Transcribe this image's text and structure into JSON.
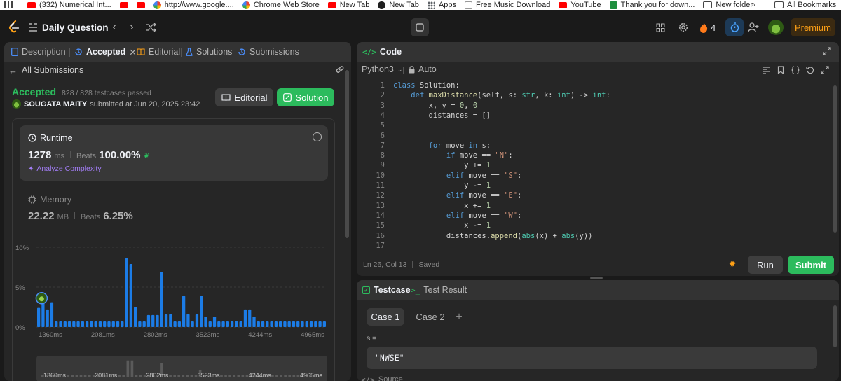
{
  "bookmarks": [
    {
      "label": "(332) Numerical Int...",
      "icon": "youtube-icon"
    },
    {
      "label": "",
      "icon": "youtube-icon"
    },
    {
      "label": "",
      "icon": "youtube-icon"
    },
    {
      "label": "http://www.google....",
      "icon": "google-icon"
    },
    {
      "label": "Chrome Web Store",
      "icon": "web-store-icon"
    },
    {
      "label": "New Tab",
      "icon": "youtube-icon"
    },
    {
      "label": "New Tab",
      "icon": "globe-icon"
    },
    {
      "label": "Apps",
      "icon": "apps-grid-icon"
    },
    {
      "label": "Free Music Download",
      "icon": "page-icon"
    },
    {
      "label": "YouTube",
      "icon": "youtube-icon"
    },
    {
      "label": "Thank you for down...",
      "icon": "download-icon"
    },
    {
      "label": "New folder",
      "icon": "folder-icon"
    }
  ],
  "bookmarks_overflow": "»",
  "all_bookmarks": "All Bookmarks",
  "topnav": {
    "title": "Daily Question",
    "streak": "4",
    "premium": "Premium"
  },
  "left_tabs": [
    "Description",
    "Accepted",
    "Editorial",
    "Solutions",
    "Submissions"
  ],
  "submission": {
    "back_label": "All Submissions",
    "status": "Accepted",
    "testcases": "828 / 828 testcases passed",
    "user": "SOUGATA MAITY",
    "submitted": "submitted at Jun 20, 2025 23:42",
    "editorial_btn": "Editorial",
    "solution_btn": "Solution"
  },
  "runtime": {
    "label": "Runtime",
    "value": "1278",
    "unit": "ms",
    "beats_label": "Beats",
    "beats": "100.00%",
    "analyze": "Analyze Complexity"
  },
  "memory": {
    "label": "Memory",
    "value": "22.22",
    "unit": "MB",
    "beats_label": "Beats",
    "beats": "6.25%"
  },
  "chart_data": {
    "type": "bar",
    "ylim": [
      0,
      10
    ],
    "yticks": [
      "10%",
      "5%",
      "0%"
    ],
    "xticks": [
      "1360ms",
      "2081ms",
      "2802ms",
      "3523ms",
      "4244ms",
      "4965ms"
    ],
    "values": [
      2.4,
      3.0,
      2.2,
      3.1,
      0.7,
      0.7,
      0.7,
      0.7,
      0.7,
      0.7,
      0.7,
      0.7,
      0.7,
      0.7,
      0.7,
      0.7,
      0.7,
      0.7,
      0.7,
      0.7,
      8.6,
      7.9,
      2.5,
      0.7,
      0.7,
      1.5,
      1.5,
      1.5,
      6.9,
      1.6,
      1.6,
      0.7,
      0.7,
      3.9,
      1.6,
      0.7,
      1.6,
      3.9,
      1.3,
      0.7,
      1.3,
      0.7,
      0.7,
      0.7,
      0.7,
      0.7,
      0.7,
      2.2,
      2.2,
      1.3,
      0.7,
      0.7,
      0.7,
      0.7,
      0.7,
      0.7,
      0.7,
      0.7,
      0.7,
      0.7,
      0.7,
      0.7,
      0.7,
      0.7,
      0.7,
      0.7
    ],
    "mini_xticks": [
      "1360ms",
      "2081ms",
      "2802ms",
      "3523ms",
      "4244ms",
      "4965ms"
    ],
    "mini_values": [
      0.4,
      0.4,
      0.4,
      0.4,
      0.4,
      0.4,
      0.4,
      0.4,
      0.4,
      0.4,
      0.4,
      0.4,
      0.4,
      0.4,
      0.4,
      0.4,
      0.4,
      0.4,
      0.4,
      0.4,
      2.6,
      2.6,
      0.4,
      0.4,
      0.4,
      0.4,
      0.4,
      0.4,
      2.2,
      0.4,
      0.4,
      0.4,
      0.4,
      0.4,
      0.4,
      0.4,
      0.4,
      1.1,
      0.4,
      0.4,
      0.4,
      0.4,
      0.4,
      0.4,
      0.4,
      0.4,
      0.4,
      0.4,
      0.4,
      0.4,
      0.4,
      0.4,
      0.4,
      0.4,
      0.4,
      0.4,
      0.4,
      0.4,
      0.4,
      0.4,
      0.4,
      0.4,
      0.4,
      0.4,
      0.4,
      0.4
    ],
    "bar_color": "#1c7ce6",
    "highlight_index": 1
  },
  "code_panel": {
    "title": "Code",
    "language": "Python3",
    "mode": "Auto",
    "status": "Ln 26, Col 13",
    "saved": "Saved",
    "run": "Run",
    "submit": "Submit"
  },
  "code_lines": [
    "class Solution:",
    "    def maxDistance(self, s: str, k: int) -> int:",
    "        x, y = 0, 0",
    "        distances = []",
    "",
    "",
    "        for move in s:",
    "            if move == \"N\":",
    "                y += 1",
    "            elif move == \"S\":",
    "                y -= 1",
    "            elif move == \"E\":",
    "                x += 1",
    "            elif move == \"W\":",
    "                x -= 1",
    "            distances.append(abs(x) + abs(y))",
    ""
  ],
  "testcase_panel": {
    "tab_testcase": "Testcase",
    "tab_result": "Test Result",
    "cases": [
      "Case 1",
      "Case 2"
    ],
    "var_label": "s =",
    "var_value": "\"NWSE\"",
    "source": "Source"
  },
  "colors": {
    "accent_green": "#2cbb5d",
    "orange": "#ffa116",
    "blue": "#1c7ce6",
    "bg": "#1a1a1a",
    "panel": "#262626"
  }
}
